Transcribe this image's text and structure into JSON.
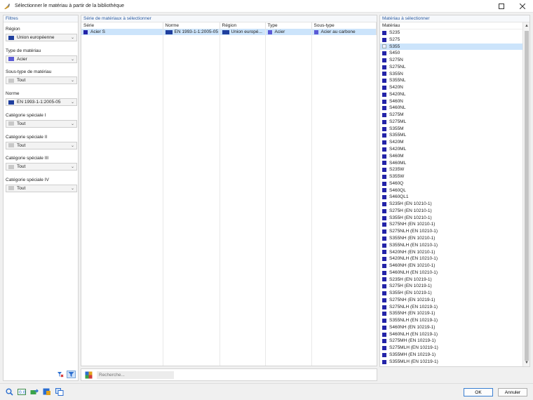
{
  "window": {
    "title": "Sélectionner le matériau à partir de la bibliothèque"
  },
  "filters": {
    "heading": "Filtres",
    "groups": [
      {
        "label": "Région",
        "value": "Union européenne",
        "swatch": "flag"
      },
      {
        "label": "Type de matériau",
        "value": "Acier",
        "swatch": "#5a5ad6"
      },
      {
        "label": "Sous-type de matériau",
        "value": "Tout",
        "swatch": "#c8c8c8"
      },
      {
        "label": "Norme",
        "value": "EN 1993-1-1:2005-05",
        "swatch": "flag"
      },
      {
        "label": "Catégorie spéciale I",
        "value": "Tout",
        "swatch": "#c8c8c8"
      },
      {
        "label": "Catégorie spéciale II",
        "value": "Tout",
        "swatch": "#c8c8c8"
      },
      {
        "label": "Catégorie spéciale III",
        "value": "Tout",
        "swatch": "#c8c8c8"
      },
      {
        "label": "Catégorie spéciale IV",
        "value": "Tout",
        "swatch": "#c8c8c8"
      }
    ]
  },
  "series": {
    "heading": "Série de matériaux à sélectionner",
    "columns": [
      "Série",
      "Norme",
      "Région",
      "Type",
      "Sous-type"
    ],
    "rows": [
      {
        "serie": "Acier S",
        "norme": "EN 1993-1-1:2005-05",
        "region": "Union europé...",
        "type": "Acier",
        "soustype": "Acier au carbone"
      }
    ]
  },
  "search": {
    "placeholder": "Recherche..."
  },
  "materials": {
    "heading": "Matériau à sélectionner",
    "column": "Matériau",
    "selected_index": 2,
    "items": [
      "S235",
      "S275",
      "S355",
      "S450",
      "S275N",
      "S275NL",
      "S355N",
      "S355NL",
      "S420N",
      "S420NL",
      "S460N",
      "S460NL",
      "S275M",
      "S275ML",
      "S355M",
      "S355ML",
      "S420M",
      "S420ML",
      "S460M",
      "S460ML",
      "S235W",
      "S355W",
      "S460Q",
      "S460QL",
      "S460QL1",
      "S235H (EN 10210-1)",
      "S275H (EN 10210-1)",
      "S355H (EN 10210-1)",
      "S275NH (EN 10210-1)",
      "S275NLH (EN 10210-1)",
      "S355NH (EN 10210-1)",
      "S355NLH (EN 10210-1)",
      "S420NH (EN 10210-1)",
      "S420NLH (EN 10210-1)",
      "S460NH (EN 10210-1)",
      "S460NLH (EN 10210-1)",
      "S235H (EN 10219-1)",
      "S275H (EN 10219-1)",
      "S355H (EN 10219-1)",
      "S275NH (EN 10219-1)",
      "S275NLH (EN 10219-1)",
      "S355NH (EN 10219-1)",
      "S355NLH (EN 10219-1)",
      "S460NH (EN 10219-1)",
      "S460NLH (EN 10219-1)",
      "S275MH (EN 10219-1)",
      "S275MLH (EN 10219-1)",
      "S355MH (EN 10219-1)",
      "S355MLH (EN 10219-1)"
    ]
  },
  "buttons": {
    "ok": "OK",
    "cancel": "Annuler"
  },
  "colors": {
    "accent": "#2a5aa0",
    "selection": "#cce4fb",
    "material_swatch": "#2323a8"
  }
}
